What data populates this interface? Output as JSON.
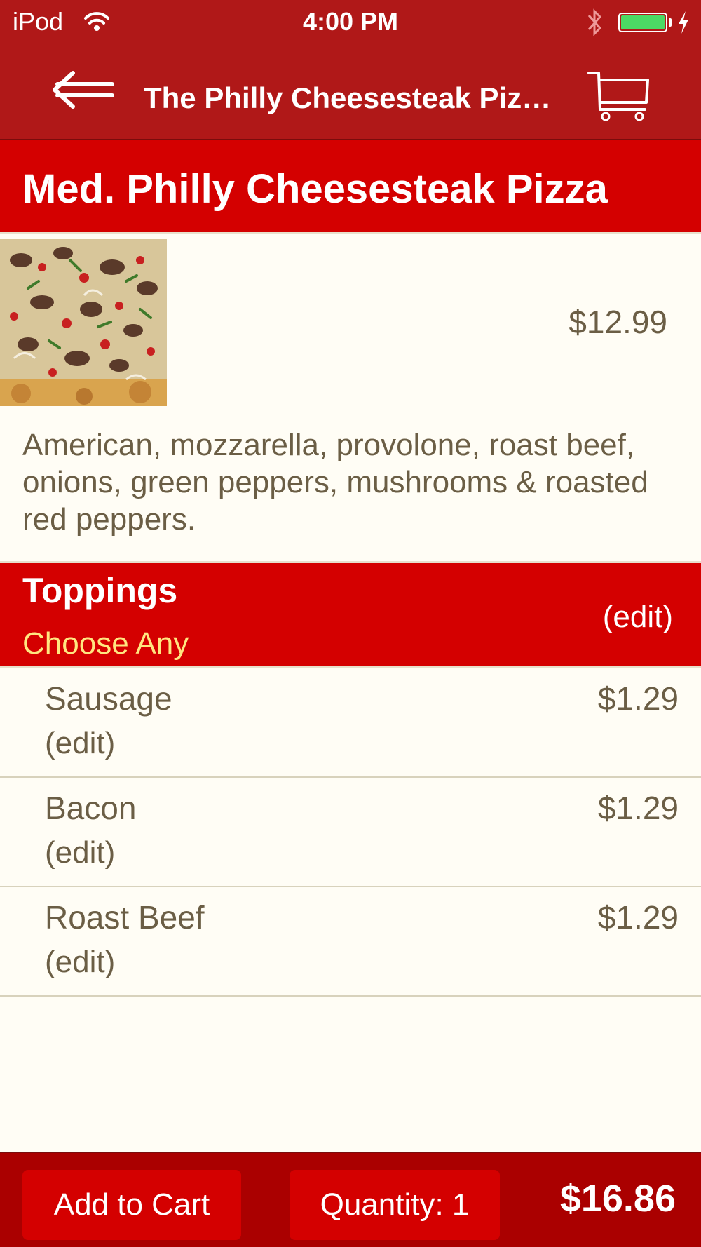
{
  "status_bar": {
    "carrier": "iPod",
    "time": "4:00 PM",
    "battery_level": 1.0
  },
  "nav": {
    "title": "The Philly Cheesesteak Piz…",
    "back_icon": "back-arrow-icon",
    "cart_icon": "cart-icon"
  },
  "item": {
    "name": "Med. Philly Cheesesteak Pizza",
    "price": "$12.99",
    "description": "American, mozzarella, provolone, roast beef, onions, green peppers, mushrooms & roasted red peppers."
  },
  "toppings": {
    "title": "Toppings",
    "subtitle": "Choose Any",
    "edit_label": "(edit)",
    "items": [
      {
        "name": "Sausage",
        "price": "$1.29",
        "edit": "(edit)"
      },
      {
        "name": "Bacon",
        "price": "$1.29",
        "edit": "(edit)"
      },
      {
        "name": "Roast Beef",
        "price": "$1.29",
        "edit": "(edit)"
      }
    ]
  },
  "bottom": {
    "add_to_cart": "Add to Cart",
    "quantity": "Quantity: 1",
    "total": "$16.86"
  },
  "colors": {
    "bar_red": "#b01818",
    "header_red": "#d40000",
    "text_brown": "#6b5e45",
    "subtitle_yellow": "#ffe680",
    "background": "#fffdf5"
  }
}
